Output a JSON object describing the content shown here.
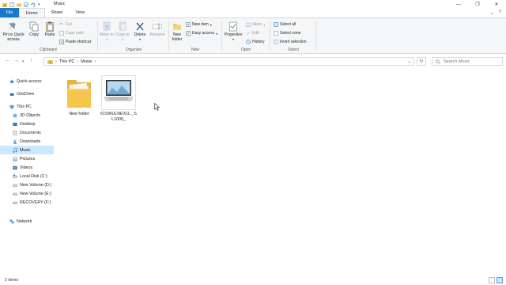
{
  "window": {
    "title": "Music"
  },
  "tabs": [
    "File",
    "Home",
    "Share",
    "View"
  ],
  "ribbon": {
    "clipboard": {
      "label": "Clipboard",
      "pin": "Pin to Quick access",
      "copy": "Copy",
      "paste": "Paste",
      "cut": "Cut",
      "copy_path": "Copy path",
      "paste_shortcut": "Paste shortcut"
    },
    "organize": {
      "label": "Organize",
      "move_to": "Move to",
      "copy_to": "Copy to",
      "delete": "Delete",
      "rename": "Rename"
    },
    "new": {
      "label": "New",
      "new_folder": "New folder",
      "new_item": "New item",
      "easy_access": "Easy access"
    },
    "open": {
      "label": "Open",
      "properties": "Properties",
      "open": "Open",
      "edit": "Edit",
      "history": "History"
    },
    "select": {
      "label": "Select",
      "select_all": "Select all",
      "select_none": "Select none",
      "invert": "Invert selection"
    }
  },
  "address": {
    "crumbs": [
      "This PC",
      "Music"
    ],
    "search_placeholder": "Search Music"
  },
  "sidebar": {
    "items": [
      {
        "label": "Quick access",
        "icon": "star-icon"
      },
      {
        "label": "OneDrive",
        "icon": "cloud-icon"
      },
      {
        "label": "This PC",
        "icon": "computer-icon"
      },
      {
        "label": "3D Objects",
        "icon": "cube-icon"
      },
      {
        "label": "Desktop",
        "icon": "desktop-icon"
      },
      {
        "label": "Documents",
        "icon": "document-icon"
      },
      {
        "label": "Downloads",
        "icon": "download-icon"
      },
      {
        "label": "Music",
        "icon": "music-icon"
      },
      {
        "label": "Pictures",
        "icon": "picture-icon"
      },
      {
        "label": "Videos",
        "icon": "video-icon"
      },
      {
        "label": "Local Disk (C:)",
        "icon": "drive-icon"
      },
      {
        "label": "New Volume (D:)",
        "icon": "drive-icon"
      },
      {
        "label": "New Volume (E:)",
        "icon": "drive-icon"
      },
      {
        "label": "RECOVERY (F:)",
        "icon": "drive-icon"
      },
      {
        "label": "Network",
        "icon": "network-icon"
      }
    ]
  },
  "files": [
    {
      "name": "New folder",
      "type": "folder"
    },
    {
      "name_line1": "61SWULNEX1L._S",
      "name_line2": "L1000_",
      "type": "image"
    }
  ],
  "status": {
    "count": "2 items"
  },
  "colors": {
    "accent": "#1979ca",
    "selection": "#cce8ff",
    "folder": "#f6c44f"
  }
}
